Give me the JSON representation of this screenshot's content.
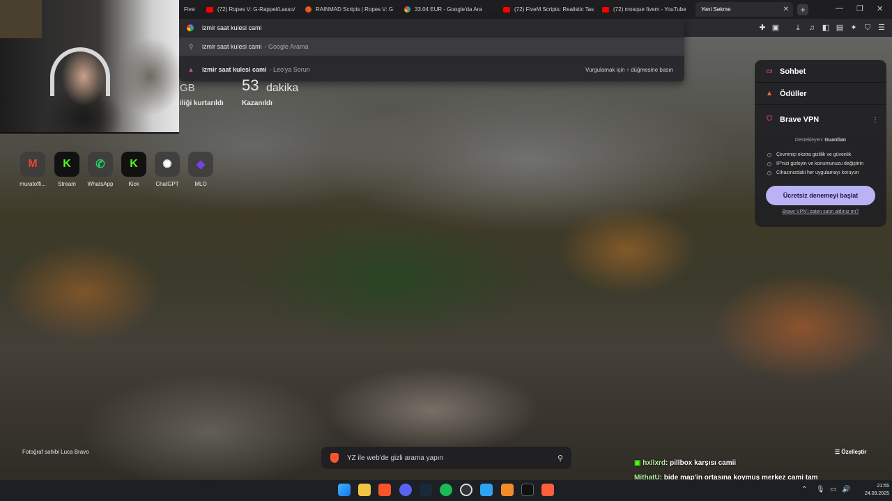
{
  "tabs": [
    {
      "label": "FiveM",
      "favicon_color": "#ff7a00"
    },
    {
      "label": "(72) Ropes V: G-Rappel/Lasso/",
      "favicon_color": "#ff0000"
    },
    {
      "label": "RAINMAD Scripts | Ropes V: G",
      "favicon_color": "#e8591e"
    },
    {
      "label": "33.04 EUR - Google'da Ara",
      "favicon_color": "#4285f4"
    },
    {
      "label": "(72) FiveM Scripts: Realistic Tas",
      "favicon_color": "#ff0000"
    },
    {
      "label": "(72) mosque fivem - YouTube",
      "favicon_color": "#ff0000"
    },
    {
      "label": "Yeni Sekme",
      "favicon_color": "#2c2c30"
    }
  ],
  "new_tab_symbol": "+",
  "omnibox": {
    "value": "izmir saat kulesi cami",
    "suggestions": [
      {
        "main": "izmir saat kulesi cami",
        "suffix": "- Google Arama",
        "icon": "search-icon"
      },
      {
        "main": "izmir saat kulesi cami",
        "suffix": "- Leo'ya Sorun",
        "icon": "leo-icon",
        "hint": "Vurgulamak için ↑ düğmesine basın"
      }
    ]
  },
  "stats": {
    "data_unit": "GB",
    "data_label": "iliği kurtarıldı",
    "time_value": "53",
    "time_unit": "dakika",
    "time_label": "Kazanıldı"
  },
  "speed_dials": [
    {
      "label": "muratoffi...",
      "glyph": "M",
      "color": "#ea4335"
    },
    {
      "label": "Stream",
      "glyph": "K",
      "color": "#53fc18"
    },
    {
      "label": "WhatsApp",
      "glyph": "✆",
      "color": "#25d366"
    },
    {
      "label": "Kick",
      "glyph": "K",
      "color": "#53fc18"
    },
    {
      "label": "ChatGPT",
      "glyph": "✺",
      "color": "#ffffff"
    },
    {
      "label": "MLO",
      "glyph": "◆",
      "color": "#7b3fe4"
    }
  ],
  "panel": {
    "chat_label": "Sohbet",
    "rewards_label": "Ödüller",
    "vpn_label": "Brave VPN",
    "supported_by": "Destekleyen:",
    "partner": "Guardian",
    "features": [
      "Çevrimiçi ekstra gizlilik ve güvenlik",
      "IP'nizi gizleyin ve konumunuzu değiştirin",
      "Cihazınızdaki her uygulamayı koruyun"
    ],
    "trial_button": "Ücretsiz denemeyi başlat",
    "already_bought": "Brave VPN'i zaten satın aldınız mı?",
    "accent": "#d13e8a"
  },
  "photo_credit": "Fotoğraf sahibi Luca Bravo",
  "search_placeholder": "YZ ile web'de gizli arama yapın",
  "customize_label": "Özelleştir",
  "chat_messages": [
    {
      "user": "hxllxrd",
      "text": ": pillbox karşısı camii"
    },
    {
      "user": "MithatU",
      "text": ": bide map'in ortasına koymuş merkez cami tam"
    }
  ],
  "clock": {
    "time": "21:55",
    "date": "24.09.2025"
  }
}
